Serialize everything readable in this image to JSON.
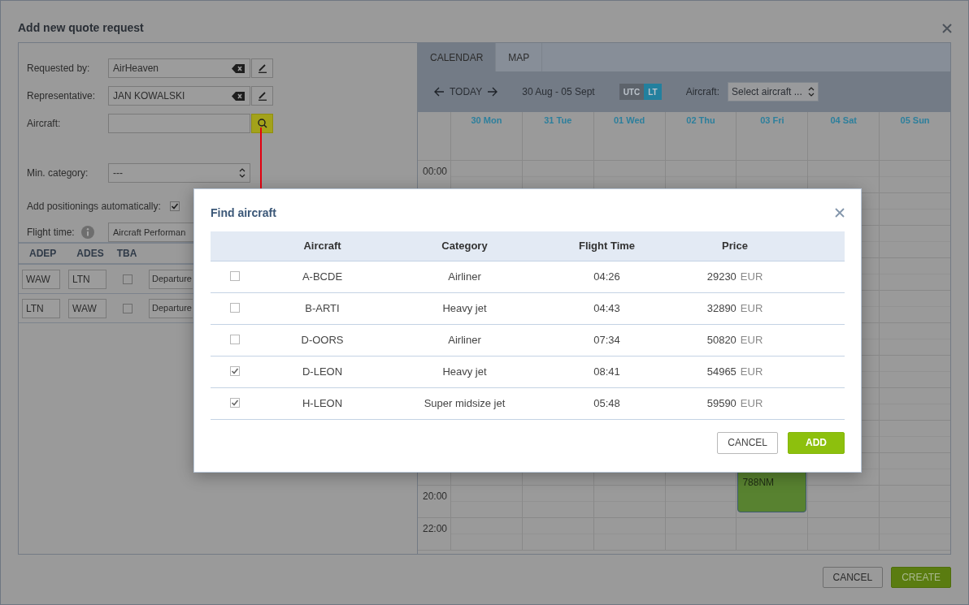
{
  "dialog": {
    "title": "Add new quote request"
  },
  "form": {
    "fields": [
      {
        "kind": "clearable",
        "label": "Requested by:",
        "value": "AirHeaven"
      },
      {
        "kind": "clearable",
        "label": "Representative:",
        "value": "JAN KOWALSKI"
      },
      {
        "kind": "search",
        "label": "Aircraft:"
      },
      {
        "kind": "select",
        "label": "Min. category:",
        "value": "---"
      },
      {
        "kind": "checkbox",
        "label": "Add positionings automatically:",
        "checked": true
      },
      {
        "kind": "info-select",
        "label": "Flight time:",
        "value": "Aircraft Performan"
      }
    ]
  },
  "legs": {
    "columns": [
      "ADEP",
      "ADES",
      "TBA"
    ],
    "rows": [
      {
        "adep": "WAW",
        "ades": "LTN",
        "tba": false,
        "type": "Departure"
      },
      {
        "adep": "LTN",
        "ades": "WAW",
        "tba": false,
        "type": "Departure"
      }
    ]
  },
  "calendar": {
    "tabs": [
      {
        "label": "CALENDAR",
        "selected": true
      },
      {
        "label": "MAP",
        "selected": false
      }
    ],
    "today": "TODAY",
    "range": "30 Aug - 05 Sept",
    "time_modes": [
      {
        "label": "UTC",
        "selected": false
      },
      {
        "label": "LT",
        "selected": true
      }
    ],
    "aircraft_label": "Aircraft:",
    "aircraft_select": "Select aircraft ...",
    "days": [
      {
        "label": "30 Mon"
      },
      {
        "label": "31 Tue"
      },
      {
        "label": "01 Wed"
      },
      {
        "label": "02 Thu"
      },
      {
        "label": "03 Fri",
        "events": [
          {
            "label": "788NM"
          }
        ]
      },
      {
        "label": "04 Sat"
      },
      {
        "label": "05 Sun"
      }
    ],
    "hours": [
      {
        "label": "00:00"
      },
      {
        "label": "20:00"
      },
      {
        "label": "22:00"
      }
    ]
  },
  "modal": {
    "title": "Find aircraft",
    "columns": [
      "Aircraft",
      "Category",
      "Flight Time",
      "Price"
    ],
    "rows": [
      {
        "checked": false,
        "aircraft": "A-BCDE",
        "category": "Airliner",
        "flight_time": "04:26",
        "price": "29230",
        "currency": "EUR"
      },
      {
        "checked": false,
        "aircraft": "B-ARTI",
        "category": "Heavy jet",
        "flight_time": "04:43",
        "price": "32890",
        "currency": "EUR"
      },
      {
        "checked": false,
        "aircraft": "D-OORS",
        "category": "Airliner",
        "flight_time": "07:34",
        "price": "50820",
        "currency": "EUR"
      },
      {
        "checked": true,
        "aircraft": "D-LEON",
        "category": "Heavy jet",
        "flight_time": "08:41",
        "price": "54965",
        "currency": "EUR"
      },
      {
        "checked": true,
        "aircraft": "H-LEON",
        "category": "Super midsize jet",
        "flight_time": "05:48",
        "price": "59590",
        "currency": "EUR"
      }
    ],
    "buttons": [
      {
        "kind": "secondary",
        "label": "CANCEL"
      },
      {
        "kind": "primary",
        "label": "ADD"
      }
    ]
  },
  "footer": {
    "buttons": [
      {
        "kind": "secondary",
        "label": "CANCEL"
      },
      {
        "kind": "primary",
        "label": "CREATE"
      }
    ]
  }
}
